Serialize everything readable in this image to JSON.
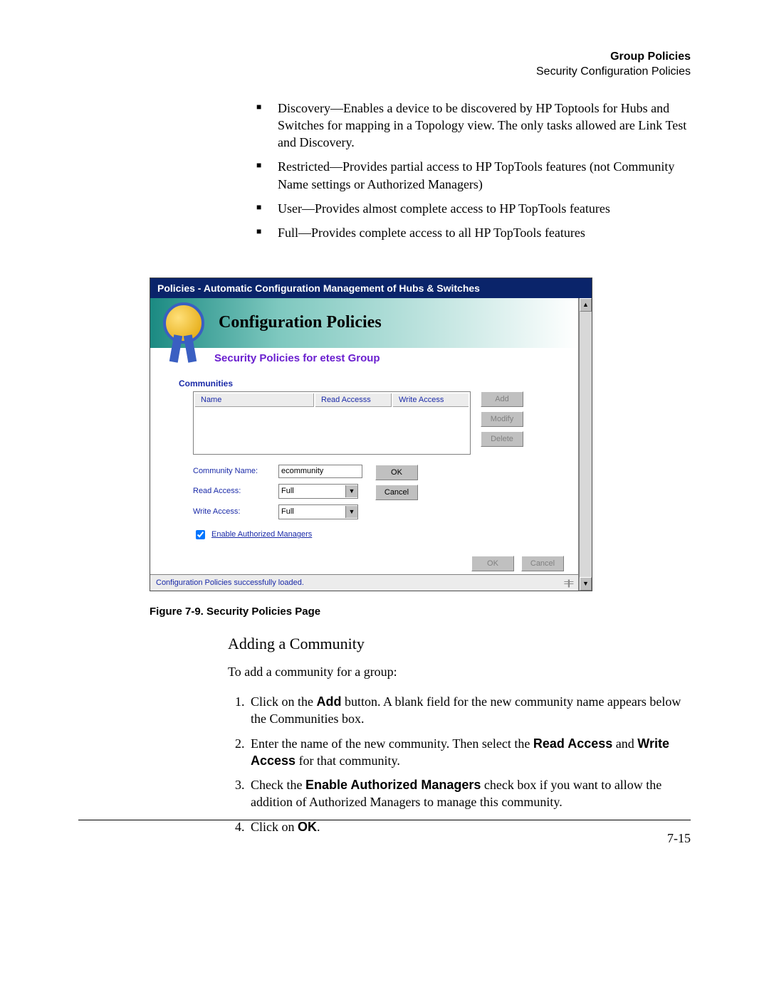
{
  "header": {
    "title": "Group Policies",
    "subtitle": "Security Configuration Policies"
  },
  "bullets": [
    "Discovery—Enables a device to be discovered by HP Toptools for Hubs and Switches for mapping in a Topology view. The only tasks allowed are Link Test and Discovery.",
    "Restricted—Provides partial access to HP TopTools features (not Community Name settings or Authorized Managers)",
    "User—Provides almost complete access to HP TopTools features",
    "Full—Provides complete access to all HP TopTools features"
  ],
  "window": {
    "title": "Policies - Automatic Configuration Management of Hubs & Switches",
    "banner_title": "Configuration Policies",
    "subtitle": "Security Policies for etest Group",
    "section": "Communities",
    "columns": {
      "name": "Name",
      "read": "Read Accesss",
      "write": "Write Access"
    },
    "buttons": {
      "add": "Add",
      "modify": "Modify",
      "delete": "Delete",
      "ok": "OK",
      "cancel": "Cancel"
    },
    "form": {
      "community_label": "Community Name:",
      "community_value": "ecommunity",
      "read_label": "Read Access:",
      "read_value": "Full",
      "write_label": "Write Access:",
      "write_value": "Full",
      "enable_label": "Enable Authorized Managers"
    },
    "status": "Configuration Policies successfully loaded."
  },
  "caption": "Figure 7-9.   Security Policies Page",
  "h3": "Adding a Community",
  "intro": "To add a community for a group:",
  "steps": {
    "s1a": "Click on the ",
    "s1b": "Add",
    "s1c": " button. A blank field for the new community name appears below the Communities box.",
    "s2a": "Enter the name of the new community. Then select the ",
    "s2b": "Read Access",
    "s2c": " and ",
    "s2d": "Write Access",
    "s2e": " for that community.",
    "s3a": "Check the ",
    "s3b": "Enable Authorized Managers",
    "s3c": " check box if you want to allow the addition of Authorized Managers to manage this community.",
    "s4a": "Click on ",
    "s4b": "OK",
    "s4c": "."
  },
  "page_number": "7-15"
}
